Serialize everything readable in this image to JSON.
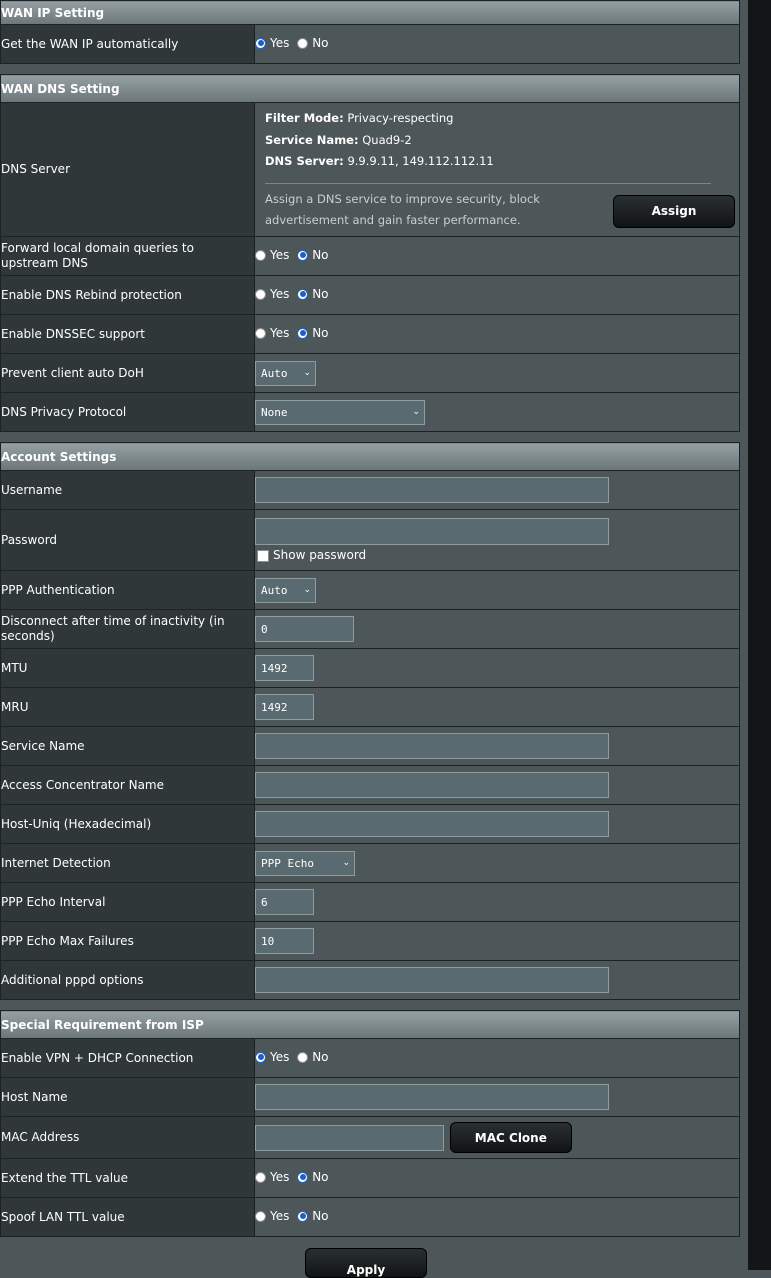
{
  "wan_ip": {
    "header": "WAN IP Setting",
    "auto_label": "Get the WAN IP automatically",
    "yes": "Yes",
    "no": "No"
  },
  "wan_dns": {
    "header": "WAN DNS Setting",
    "dns_server_label": "DNS Server",
    "filter_mode_key": "Filter Mode:",
    "filter_mode_val": "Privacy-respecting",
    "service_name_key": "Service Name:",
    "service_name_val": "Quad9-2",
    "dns_server_key": "DNS Server:",
    "dns_server_val": "9.9.9.11, 149.112.112.11",
    "assign_desc": "Assign a DNS service to improve security, block advertisement and gain faster performance.",
    "assign_button": "Assign",
    "forward_label": "Forward local domain queries to upstream DNS",
    "rebind_label": "Enable DNS Rebind protection",
    "dnssec_label": "Enable DNSSEC support",
    "doh_label": "Prevent client auto DoH",
    "doh_value": "Auto",
    "privacy_label": "DNS Privacy Protocol",
    "privacy_value": "None",
    "yes": "Yes",
    "no": "No"
  },
  "account": {
    "header": "Account Settings",
    "username_label": "Username",
    "username_value": "",
    "password_label": "Password",
    "password_value": "",
    "show_password": "Show password",
    "ppp_auth_label": "PPP Authentication",
    "ppp_auth_value": "Auto",
    "idle_label": "Disconnect after time of inactivity (in seconds)",
    "idle_value": "0",
    "mtu_label": "MTU",
    "mtu_value": "1492",
    "mru_label": "MRU",
    "mru_value": "1492",
    "service_name_label": "Service Name",
    "service_name_value": "",
    "ac_name_label": "Access Concentrator Name",
    "ac_name_value": "",
    "host_uniq_label": "Host-Uniq (Hexadecimal)",
    "host_uniq_value": "",
    "detection_label": "Internet Detection",
    "detection_value": "PPP Echo",
    "echo_interval_label": "PPP Echo Interval",
    "echo_interval_value": "6",
    "echo_max_label": "PPP Echo Max Failures",
    "echo_max_value": "10",
    "pppd_label": "Additional pppd options",
    "pppd_value": ""
  },
  "isp": {
    "header": "Special Requirement from ISP",
    "vpn_dhcp_label": "Enable VPN + DHCP Connection",
    "host_name_label": "Host Name",
    "host_name_value": "",
    "mac_label": "MAC Address",
    "mac_value": "",
    "mac_clone_button": "MAC Clone",
    "ttl_label": "Extend the TTL value",
    "spoof_ttl_label": "Spoof LAN TTL value",
    "yes": "Yes",
    "no": "No"
  },
  "apply_button": "Apply",
  "radio_states": {
    "wan_ip_auto": "yes",
    "forward_local": "no",
    "dns_rebind": "no",
    "dnssec": "no",
    "vpn_dhcp": "yes",
    "extend_ttl": "no",
    "spoof_ttl": "no"
  },
  "show_password_checked": false,
  "accent_color": "#1f5fc2"
}
